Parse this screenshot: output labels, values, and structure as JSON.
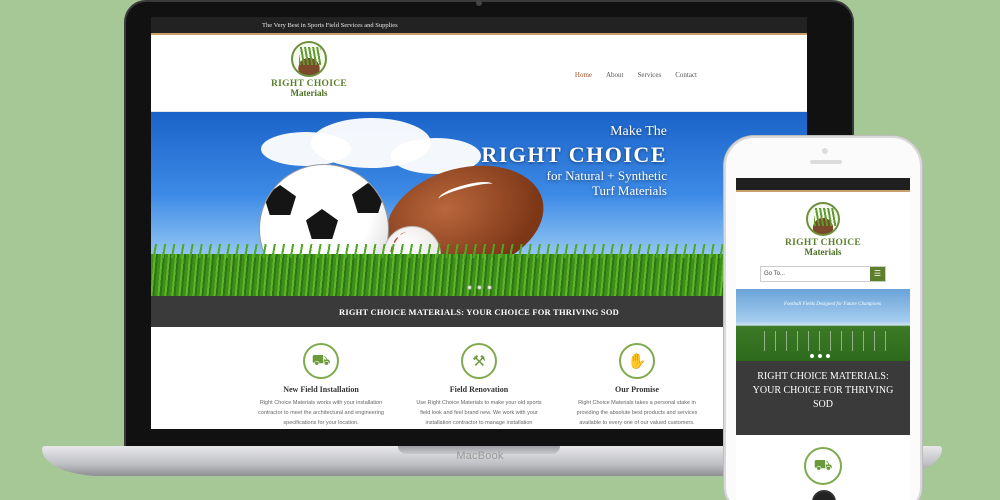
{
  "device_label": "MacBook",
  "site": {
    "tagline": "The Very Best in Sports Field Services and Supplies",
    "logo_line1": "RIGHT CHOICE",
    "logo_line2": "Materials",
    "nav": [
      "Home",
      "About",
      "Services",
      "Contact"
    ],
    "hero": {
      "line1": "Make The",
      "line2": "RIGHT CHOICE",
      "line3": "for Natural + Synthetic",
      "line4": "Turf Materials"
    },
    "band": "RIGHT CHOICE MATERIALS: YOUR CHOICE FOR THRIVING SOD",
    "features": [
      {
        "icon": "wheelbarrow-icon",
        "glyph": "⛟",
        "title": "New Field Installation",
        "body": "Right Choice Materials works with your installation contractor to meet the architectural and engineering specifications for your location."
      },
      {
        "icon": "shovel-icon",
        "glyph": "⚒",
        "title": "Field Renovation",
        "body": "Use Right Choice Materials to make your old sports field look and feel brand new. We work with your installation contractor to manage installation"
      },
      {
        "icon": "handshake-icon",
        "glyph": "✋",
        "title": "Our Promise",
        "body": "Right Choice Materials takes a personal stake in providing the absolute best products and services available to every one of our valued customers."
      }
    ]
  },
  "mobile": {
    "logo_line1": "RIGHT CHOICE",
    "logo_line2": "Materials",
    "select_text": "Go To...",
    "hero_text": "Football Fields Designed for Future Champions",
    "band_text": "RIGHT CHOICE MATERIALS: YOUR CHOICE FOR THRIVING SOD",
    "feature_glyph": "⛟"
  },
  "colors": {
    "background": "#a6c796",
    "brand_green": "#5b7f2a",
    "accent": "#c8a06b",
    "band": "#3a3a3a",
    "nav_active": "#a0522d"
  }
}
